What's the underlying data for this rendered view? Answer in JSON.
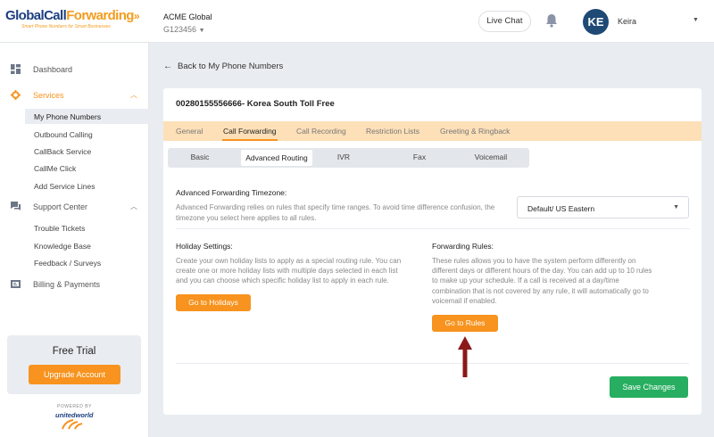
{
  "brand": {
    "logo_main": "GlobalCall",
    "logo_accent": "Forwarding",
    "tagline": "Smart Phone Numbers for Smart Businesses"
  },
  "account": {
    "name": "ACME Global",
    "number": "G123456"
  },
  "header": {
    "live_chat": "Live Chat",
    "avatar_initials": "KE",
    "username": "Keira"
  },
  "sidebar": {
    "dashboard": "Dashboard",
    "services": "Services",
    "services_items": [
      "My Phone Numbers",
      "Outbound Calling",
      "CallBack Service",
      "CallMe Click",
      "Add Service Lines"
    ],
    "support": "Support Center",
    "support_items": [
      "Trouble Tickets",
      "Knowledge Base",
      "Feedback / Surveys"
    ],
    "billing": "Billing & Payments"
  },
  "trial": {
    "title": "Free Trial",
    "button": "Upgrade Account",
    "powered_by": "POWERED BY",
    "partner": "unitedworld"
  },
  "main": {
    "back_link": "Back to My Phone Numbers",
    "number_title": "00280155556666- Korea South Toll Free",
    "tabs": [
      "General",
      "Call Forwarding",
      "Call Recording",
      "Restriction Lists",
      "Greeting & Ringback"
    ],
    "subtabs": [
      "Basic",
      "Advanced Routing",
      "IVR",
      "Fax",
      "Voicemail"
    ],
    "timezone": {
      "title": "Advanced Forwarding Timezone:",
      "text1": "Advanced Forwarding relies on rules that specify time ranges. To avoid time difference confusion, the",
      "text2": "timezone you select here applies to all rules.",
      "selected": "Default/ US Eastern"
    },
    "holiday": {
      "title": "Holiday Settings:",
      "lines": [
        "Create your own holiday lists to apply as a special routing rule. You can",
        "create one or more holiday lists with multiple days selected in each list",
        "and you can choose which specific holiday list to apply in each rule."
      ],
      "button": "Go to Holidays"
    },
    "rules": {
      "title": "Forwarding Rules:",
      "lines": [
        "These rules allows you to have the system perform differently on",
        "different days or different hours of the day. You can add up to 10 rules",
        "to make up your schedule. If a call is received at a day/time",
        "combination that is not covered by any rule, it will automatically go to",
        "voicemail if enabled."
      ],
      "button": "Go to Rules"
    },
    "save": "Save Changes"
  },
  "colors": {
    "brand_navy": "#1d3f80",
    "accent_orange": "#f7931e",
    "save_green": "#27ae60",
    "arrow_red": "#8b1a1a"
  }
}
